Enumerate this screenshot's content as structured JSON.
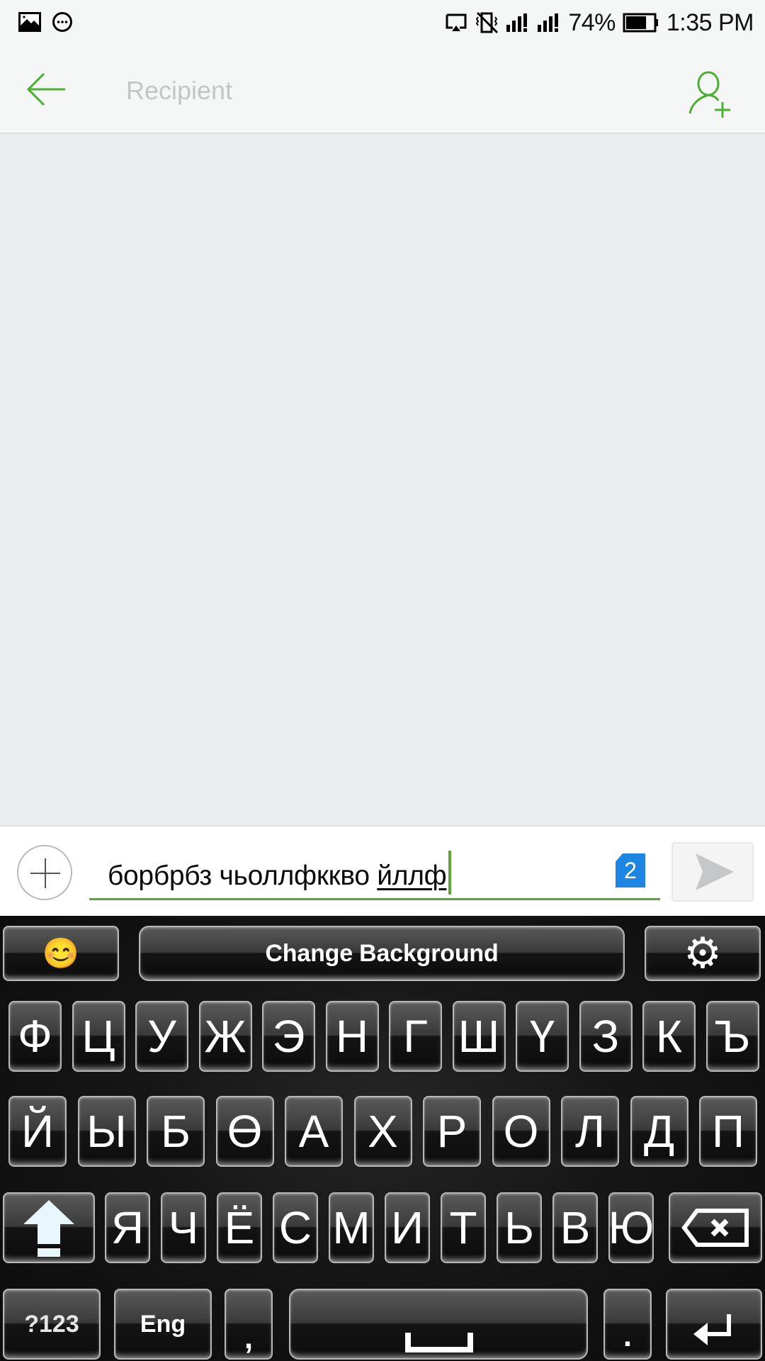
{
  "status_bar": {
    "left_icons": [
      "gallery-notification-icon",
      "more-notification-icon"
    ],
    "right_icons": [
      "cast-icon",
      "vibrate-off-icon",
      "signal-sim1-icon",
      "signal-sim2-icon",
      "battery-icon"
    ],
    "battery_percent": "74%",
    "battery_level": 0.74,
    "time": "1:35 PM"
  },
  "app_bar": {
    "back_icon": "arrow-left-icon",
    "recipient_placeholder": "Recipient",
    "recipient_value": "",
    "add_contact_icon": "add-person-icon",
    "accent_color": "#4caf32"
  },
  "compose": {
    "attach_icon": "plus-circle-icon",
    "message_committed": "борбрбз чьоллфккво ",
    "message_composing": "йллф",
    "sim_badge": "2",
    "sim_badge_color": "#1d86e3",
    "send_icon": "send-icon",
    "underline_color": "#5fa33a"
  },
  "keyboard": {
    "toolbar": {
      "emoji_icon": "smiley-emoji-icon",
      "emoji_glyph": "😊",
      "change_background_label": "Change Background",
      "settings_icon": "gear-icon",
      "settings_glyph": "⚙"
    },
    "rows": [
      [
        "Ф",
        "Ц",
        "У",
        "Ж",
        "Э",
        "Н",
        "Г",
        "Ш",
        "Ү",
        "З",
        "К",
        "Ъ"
      ],
      [
        "Й",
        "Ы",
        "Б",
        "Ө",
        "А",
        "Х",
        "Р",
        "О",
        "Л",
        "Д",
        "П"
      ],
      [
        "Я",
        "Ч",
        "Ё",
        "С",
        "М",
        "И",
        "Т",
        "Ь",
        "В",
        "Ю"
      ]
    ],
    "shift_icon": "shift-arrow-icon",
    "backspace_icon": "backspace-icon",
    "bottom_row": {
      "symbols_label": "?123",
      "language_label": "Eng",
      "comma_label": ",",
      "space_icon": "space-bar-icon",
      "period_label": ".",
      "enter_icon": "enter-icon"
    }
  }
}
